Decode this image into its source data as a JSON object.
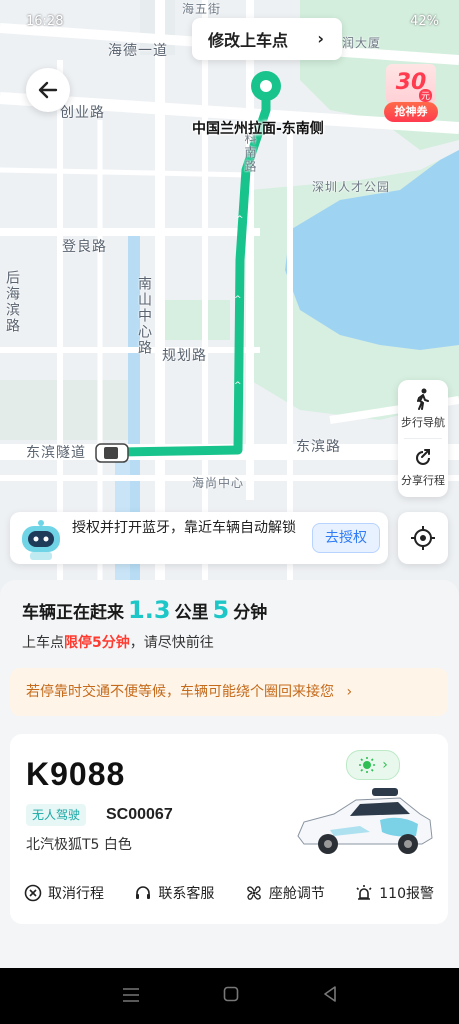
{
  "status_bar": {
    "time": "16:28",
    "battery": "42%"
  },
  "map": {
    "modify_pickup_label": "修改上车点",
    "pickup_name": "中国兰州拉面-东南侧",
    "coupon": {
      "amount": "30",
      "unit": "元",
      "label": "抢神券"
    },
    "labels": {
      "haide": "海德一道",
      "chuangye": "创业路",
      "dengliang": "登良路",
      "nanshan": "南山中心路",
      "guihua": "规划路",
      "houhai": "后海滨路",
      "dongbin_tunnel": "东滨隧道",
      "dongbin": "东滨路",
      "haishang": "海尚中心",
      "talent_park": "深圳人才公园",
      "runda": "润大厦",
      "haiwu": "海五街",
      "kenan": "科南路"
    },
    "side_buttons": {
      "walk_nav": "步行导航",
      "share_trip": "分享行程"
    },
    "bluetooth_banner": {
      "text": "授权并打开蓝牙，靠近车辆自动解锁",
      "button": "去授权"
    }
  },
  "trip": {
    "prefix": "车辆正在赶来",
    "distance": "1.3",
    "distance_unit": "公里",
    "minutes": "5",
    "minutes_unit": "分钟",
    "sub_prefix": "上车点",
    "sub_highlight": "限停5分钟",
    "sub_suffix": "，请尽快前往",
    "notice": "若停靠时交通不便等候，车辆可能绕个圈回来接您"
  },
  "vehicle": {
    "plate": "K9088",
    "tag": "无人驾驶",
    "code": "SC00067",
    "model": "北汽极狐T5 白色"
  },
  "actions": [
    {
      "label": "取消行程",
      "icon": "cancel-circle-icon"
    },
    {
      "label": "联系客服",
      "icon": "headset-icon"
    },
    {
      "label": "座舱调节",
      "icon": "fan-icon"
    },
    {
      "label": "110报警",
      "icon": "alarm-icon"
    }
  ],
  "colors": {
    "route": "#19c48c",
    "accent": "#1ec7c7",
    "warning": "#ff3b30",
    "notice_text": "#c46a1a"
  }
}
